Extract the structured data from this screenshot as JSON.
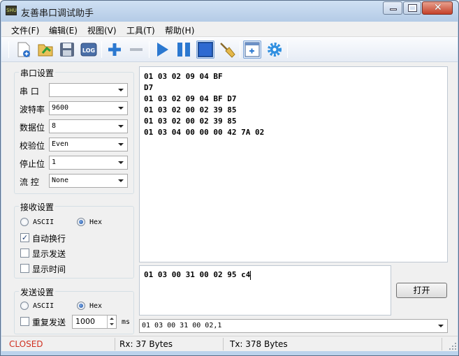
{
  "window": {
    "title": "友善串口调试助手",
    "app_icon_text": "SHU"
  },
  "menu": [
    {
      "label": "文件(F)"
    },
    {
      "label": "编辑(E)"
    },
    {
      "label": "视图(V)"
    },
    {
      "label": "工具(T)"
    },
    {
      "label": "帮助(H)"
    }
  ],
  "toolbar": {
    "log_label": "LOG",
    "icons": [
      "new-file-icon",
      "open-folder-icon",
      "save-icon",
      "log-icon",
      "add-icon",
      "remove-icon",
      "play-icon",
      "pause-icon",
      "window-icon",
      "broom-icon",
      "add-window-icon",
      "gear-icon"
    ]
  },
  "serial_settings": {
    "title": "串口设置",
    "port_label": "串  口",
    "port_value": "",
    "baud_label": "波特率",
    "baud_value": "9600",
    "databits_label": "数据位",
    "databits_value": "8",
    "parity_label": "校验位",
    "parity_value": "Even",
    "stopbits_label": "停止位",
    "stopbits_value": "1",
    "flow_label": "流  控",
    "flow_value": "None"
  },
  "receive_settings": {
    "title": "接收设置",
    "ascii_label": "ASCII",
    "hex_label": "Hex",
    "selected": "Hex",
    "auto_wrap_label": "自动换行",
    "auto_wrap_checked": true,
    "show_send_label": "显示发送",
    "show_send_checked": false,
    "show_time_label": "显示时间",
    "show_time_checked": false
  },
  "send_settings": {
    "title": "发送设置",
    "ascii_label": "ASCII",
    "hex_label": "Hex",
    "selected": "Hex",
    "repeat_label": "重复发送",
    "repeat_checked": false,
    "interval_value": "1000",
    "interval_unit": "ms"
  },
  "receive_area": {
    "lines": [
      "01 03 02 09 04 BF",
      "D7",
      "01 03 02 09 04 BF D7",
      "01 03 02 00 02 39 85",
      "01 03 02 00 02 39 85",
      "01 03 04 00 00 00 42 7A 02"
    ]
  },
  "send_area": {
    "text": "01 03 00 31 00 02 95 c4"
  },
  "open_button_label": "打开",
  "history_combo_value": "01 03 00 31 00 02,1",
  "status": {
    "state": "CLOSED",
    "state_color": "#d03020",
    "rx": "Rx: 37 Bytes",
    "tx": "Tx: 378 Bytes"
  }
}
